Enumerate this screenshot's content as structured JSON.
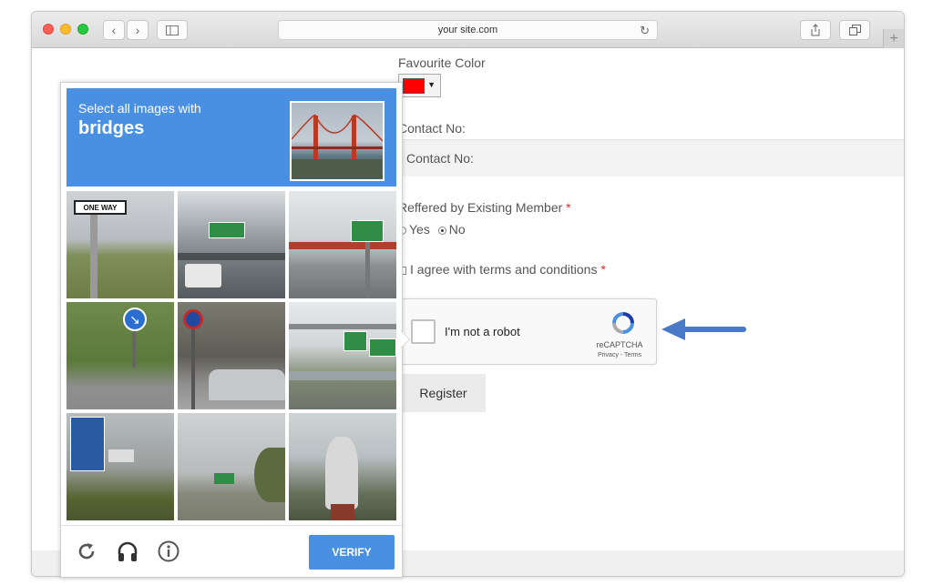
{
  "browser": {
    "address": "your site.com",
    "back_icon": "chevron-left-icon",
    "forward_icon": "chevron-right-icon",
    "sidebar_icon": "sidebar-icon",
    "reload_icon": "reload-icon",
    "share_icon": "share-icon",
    "tabs_icon": "tabs-icon",
    "newtab_label": "+"
  },
  "form": {
    "favourite_color_label": "Favourite Color",
    "favourite_color_value": "#ff0000",
    "contact_label": "Contact No:",
    "contact_placeholder": "Contact No:",
    "referred_label": "Reffered by Existing Member",
    "required_mark": "*",
    "yes_label": "Yes",
    "no_label": "No",
    "referred_selected": "No",
    "terms_label": "I agree with terms and conditions",
    "register_label": "Register"
  },
  "recaptcha": {
    "checkbox_label": "I'm not a robot",
    "brand": "reCAPTCHA",
    "links": "Privacy - Terms"
  },
  "challenge": {
    "instruction": "Select all images with",
    "target": "bridges",
    "verify_label": "VERIFY",
    "tiles": [
      {
        "sign": "ONE WAY"
      },
      {
        "sign": ""
      },
      {
        "sign": ""
      },
      {
        "sign": ""
      },
      {
        "sign": ""
      },
      {
        "sign": ""
      },
      {
        "sign": ""
      },
      {
        "sign": ""
      },
      {
        "sign": ""
      }
    ]
  },
  "colors": {
    "accent": "#4a90e2",
    "required": "#d62f2f"
  }
}
